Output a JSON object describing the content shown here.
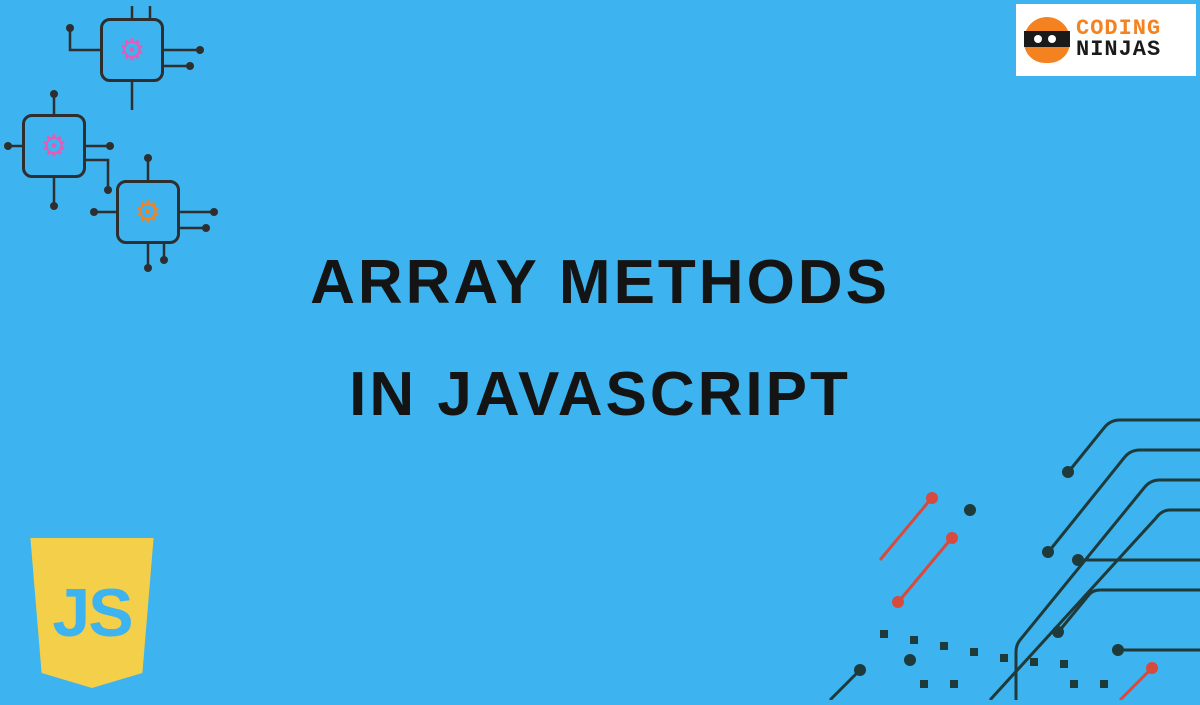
{
  "title": {
    "line1": "Array Methods",
    "line2": "in Javascript"
  },
  "brand": {
    "word1": "CODING",
    "word2": "NINJAS"
  },
  "js_badge": {
    "text": "JS"
  },
  "colors": {
    "background": "#3db3ef",
    "title_text": "#141414",
    "shield": "#f3cf4a",
    "brand_accent": "#f58220",
    "circuit_dark": "#1f3a3a",
    "circuit_accent": "#d84a3d"
  },
  "decorations": {
    "top_left": "chip-gear-icons",
    "bottom_right": "circuit-traces"
  }
}
